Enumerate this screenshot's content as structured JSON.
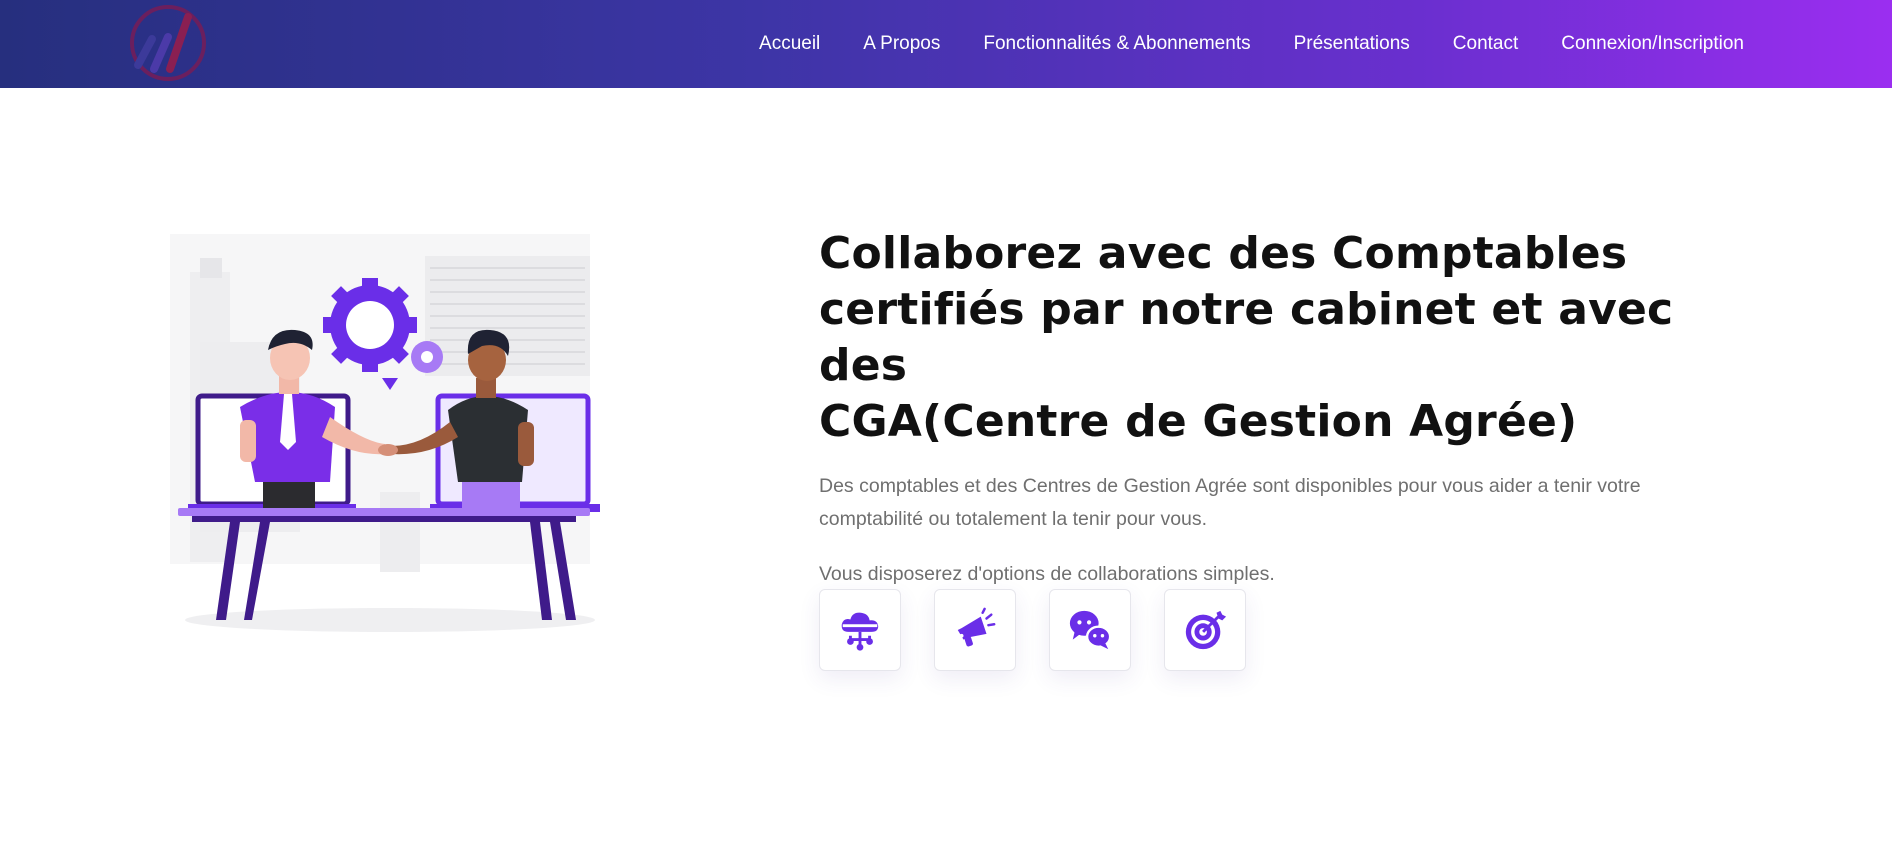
{
  "colors": {
    "brand_gradient_start": "#262f7e",
    "brand_gradient_end": "#9b2ef0",
    "accent": "#6a2ee8"
  },
  "header": {
    "logo_icon": "chart-bars-logo-icon",
    "nav": [
      {
        "label": "Accueil"
      },
      {
        "label": "A Propos"
      },
      {
        "label": "Fonctionnalités & Abonnements"
      },
      {
        "label": "Présentations"
      },
      {
        "label": "Contact"
      },
      {
        "label": "Connexion/Inscription"
      }
    ]
  },
  "hero": {
    "illustration": "handshake-collaboration-illustration",
    "headline_lines": [
      "Collaborez avec des Comptables",
      "certifiés par notre cabinet et avec des",
      "CGA(Centre de Gestion Agrée)"
    ],
    "description_lines": [
      "Des comptables et des Centres de Gestion Agrée sont disponibles pour vous aider a tenir votre",
      "comptabilité ou totalement la tenir pour vous."
    ],
    "note": "Vous disposerez d'options de collaborations simples."
  },
  "features": [
    {
      "icon": "cloud-network-icon"
    },
    {
      "icon": "megaphone-icon"
    },
    {
      "icon": "chat-bubbles-icon"
    },
    {
      "icon": "target-icon"
    }
  ]
}
